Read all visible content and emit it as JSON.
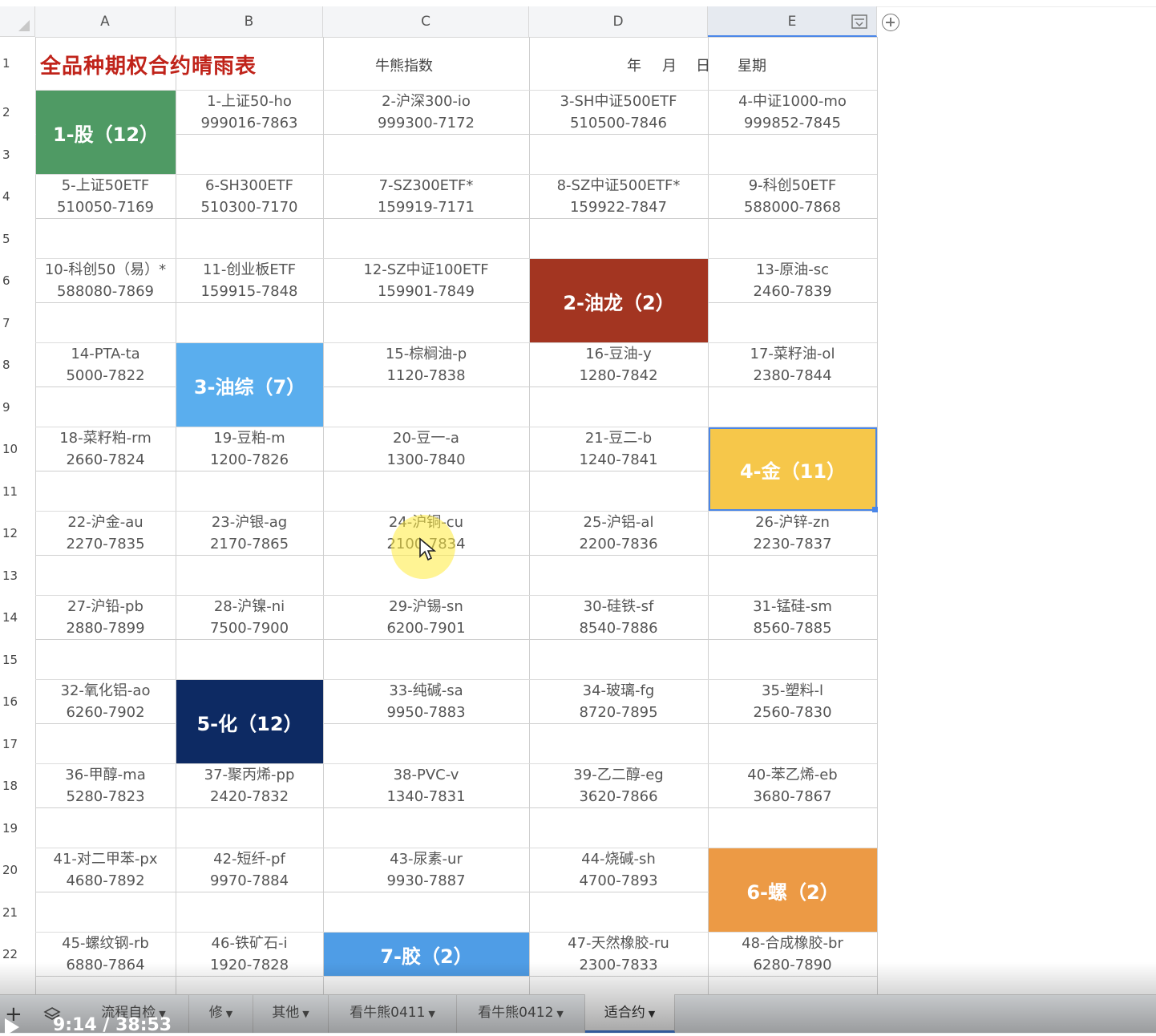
{
  "columns": [
    "A",
    "B",
    "C",
    "D",
    "E"
  ],
  "rows": [
    "1",
    "2",
    "3",
    "4",
    "5",
    "6",
    "7",
    "8",
    "9",
    "10",
    "11",
    "12",
    "13",
    "14",
    "15",
    "16",
    "17",
    "18",
    "19",
    "20",
    "21",
    "22"
  ],
  "row1": {
    "title": "全品种期权合约晴雨表",
    "index_label": "牛熊指数",
    "year": "年",
    "month": "月",
    "day": "日",
    "weekday": "星期"
  },
  "cells": [
    {
      "l1": "1-上证50-ho",
      "l2": "999016-7863"
    },
    {
      "l1": "2-沪深300-io",
      "l2": "999300-7172"
    },
    {
      "l1": "3-SH中证500ETF",
      "l2": "510500-7846"
    },
    {
      "l1": "4-中证1000-mo",
      "l2": "999852-7845"
    },
    {
      "l1": "5-上证50ETF",
      "l2": "510050-7169"
    },
    {
      "l1": "6-SH300ETF",
      "l2": "510300-7170"
    },
    {
      "l1": "7-SZ300ETF*",
      "l2": "159919-7171"
    },
    {
      "l1": "8-SZ中证500ETF*",
      "l2": "159922-7847"
    },
    {
      "l1": "9-科创50ETF",
      "l2": "588000-7868"
    },
    {
      "l1": "10-科创50（易）*",
      "l2": "588080-7869"
    },
    {
      "l1": "11-创业板ETF",
      "l2": "159915-7848"
    },
    {
      "l1": "12-SZ中证100ETF",
      "l2": "159901-7849"
    },
    {
      "l1": "13-原油-sc",
      "l2": "2460-7839"
    },
    {
      "l1": "14-PTA-ta",
      "l2": "5000-7822"
    },
    {
      "l1": "15-棕榈油-p",
      "l2": "1120-7838"
    },
    {
      "l1": "16-豆油-y",
      "l2": "1280-7842"
    },
    {
      "l1": "17-菜籽油-ol",
      "l2": "2380-7844"
    },
    {
      "l1": "18-菜籽粕-rm",
      "l2": "2660-7824"
    },
    {
      "l1": "19-豆粕-m",
      "l2": "1200-7826"
    },
    {
      "l1": "20-豆一-a",
      "l2": "1300-7840"
    },
    {
      "l1": "21-豆二-b",
      "l2": "1240-7841"
    },
    {
      "l1": "22-沪金-au",
      "l2": "2270-7835"
    },
    {
      "l1": "23-沪银-ag",
      "l2": "2170-7865"
    },
    {
      "l1": "24-沪铜-cu",
      "l2": "2100-7834"
    },
    {
      "l1": "25-沪铝-al",
      "l2": "2200-7836"
    },
    {
      "l1": "26-沪锌-zn",
      "l2": "2230-7837"
    },
    {
      "l1": "27-沪铅-pb",
      "l2": "2880-7899"
    },
    {
      "l1": "28-沪镍-ni",
      "l2": "7500-7900"
    },
    {
      "l1": "29-沪锡-sn",
      "l2": "6200-7901"
    },
    {
      "l1": "30-硅铁-sf",
      "l2": "8540-7886"
    },
    {
      "l1": "31-锰硅-sm",
      "l2": "8560-7885"
    },
    {
      "l1": "32-氧化铝-ao",
      "l2": "6260-7902"
    },
    {
      "l1": "33-纯碱-sa",
      "l2": "9950-7883"
    },
    {
      "l1": "34-玻璃-fg",
      "l2": "8720-7895"
    },
    {
      "l1": "35-塑料-l",
      "l2": "2560-7830"
    },
    {
      "l1": "36-甲醇-ma",
      "l2": "5280-7823"
    },
    {
      "l1": "37-聚丙烯-pp",
      "l2": "2420-7832"
    },
    {
      "l1": "38-PVC-v",
      "l2": "1340-7831"
    },
    {
      "l1": "39-乙二醇-eg",
      "l2": "3620-7866"
    },
    {
      "l1": "40-苯乙烯-eb",
      "l2": "3680-7867"
    },
    {
      "l1": "41-对二甲苯-px",
      "l2": "4680-7892"
    },
    {
      "l1": "42-短纤-pf",
      "l2": "9970-7884"
    },
    {
      "l1": "43-尿素-ur",
      "l2": "9930-7887"
    },
    {
      "l1": "44-烧碱-sh",
      "l2": "4700-7893"
    },
    {
      "l1": "45-螺纹钢-rb",
      "l2": "6880-7864"
    },
    {
      "l1": "46-铁矿石-i",
      "l2": "1920-7828"
    },
    {
      "l1": "47-天然橡胶-ru",
      "l2": "2300-7833"
    },
    {
      "l1": "48-合成橡胶-br",
      "l2": "6280-7890"
    }
  ],
  "blocks": [
    {
      "label": "1-股（12）",
      "color": "#4f9a64"
    },
    {
      "label": "2-油龙（2）",
      "color": "#a33521"
    },
    {
      "label": "3-油综（7）",
      "color": "#5aaeee"
    },
    {
      "label": "4-金（11）",
      "color": "#f6c74a"
    },
    {
      "label": "5-化（12）",
      "color": "#0d2a63"
    },
    {
      "label": "6-螺（2）",
      "color": "#ec9a45"
    },
    {
      "label": "7-胶（2）",
      "color": "#4f9de6"
    }
  ],
  "tabs": [
    {
      "label": "流程自检"
    },
    {
      "label": "修"
    },
    {
      "label": "其他"
    },
    {
      "label": "看牛熊0411"
    },
    {
      "label": "看牛熊0412"
    },
    {
      "label": "适合约",
      "active": true
    }
  ],
  "video": {
    "time": "9:14 / 38:53"
  }
}
